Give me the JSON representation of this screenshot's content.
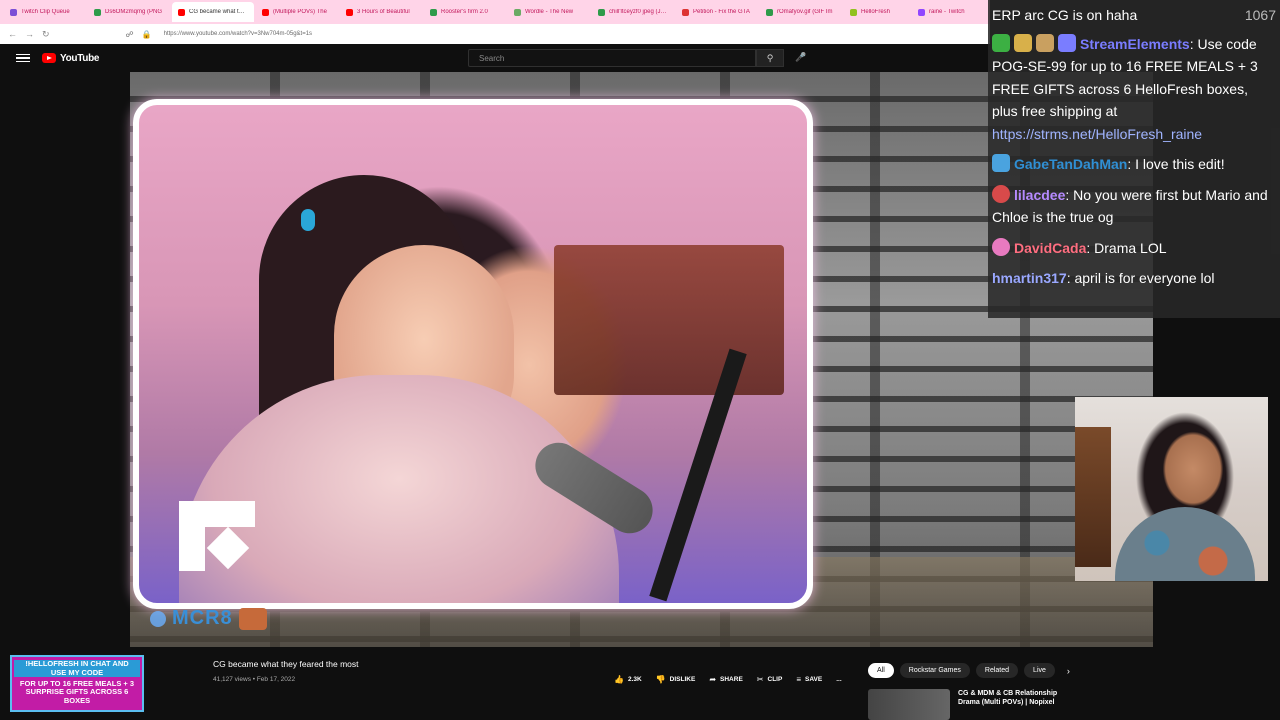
{
  "browser": {
    "tabs": [
      {
        "label": "Twitch Clip Queue",
        "color": "#7b4fd6"
      },
      {
        "label": "Ds6OM2mqmg (PNG",
        "color": "#2e9b4a"
      },
      {
        "label": "CG became what they feared",
        "color": "#ff0000",
        "active": true
      },
      {
        "label": "(Multiple POVs) The",
        "color": "#ff0000"
      },
      {
        "label": "3 Hours of Beautiful",
        "color": "#ff0000"
      },
      {
        "label": "Rooster's firm 2.0",
        "color": "#2e9b4a"
      },
      {
        "label": "Wordle - The New",
        "color": "#6aaa64"
      },
      {
        "label": "chill'ltceyzf0 jpeg (JPEG",
        "color": "#2e9b4a"
      },
      {
        "label": "Petition - Fix the GTA",
        "color": "#d33"
      },
      {
        "label": "rOmafyov.gif (GIF Im",
        "color": "#2e9b4a"
      },
      {
        "label": "HelloFresh",
        "color": "#91c11e"
      },
      {
        "label": "raine - Twitch",
        "color": "#9146ff"
      }
    ],
    "url": "https://www.youtube.com/watch?v=3Nw704m-05g&t=1s"
  },
  "youtube": {
    "brand": "YouTube",
    "search_placeholder": "Search",
    "video_title": "CG became what they feared the most",
    "video_meta": "41,127 views • Feb 17, 2022",
    "actions": {
      "like": "2.3K",
      "dislike": "DISLIKE",
      "share": "SHARE",
      "clip": "CLIP",
      "save": "SAVE",
      "more": "..."
    },
    "chips": [
      "All",
      "Rockstar Games",
      "Related",
      "Live"
    ],
    "related_title": "CG & MDM & CB Relationship Drama (Multi POVs) | Nopixel"
  },
  "stream": {
    "streamer_label": "MCR8",
    "viewer_count": "1067",
    "promo": {
      "line1": "!HELLOFRESH IN CHAT AND USE MY CODE",
      "line2": "FOR UP TO 16 FREE MEALS + 3 SURPRISE GIFTS ACROSS 6 BOXES"
    }
  },
  "chat": [
    {
      "user": "",
      "text": "ERP arc CG is on haha",
      "color": "#ffffff"
    },
    {
      "user": "StreamElements",
      "text": ": Use code POG-SE-99 for up to 16 FREE MEALS + 3 FREE GIFTS across 6 HelloFresh boxes, plus free shipping at ",
      "link": "https://strms.net/HelloFresh_raine",
      "color": "#7a7dff"
    },
    {
      "user": "GabeTanDahMan",
      "text": ": I love this edit!",
      "color": "#2f8fd4"
    },
    {
      "user": "lilacdee",
      "text": ": No you were first but Mario and Chloe is the true og",
      "color": "#b58aff"
    },
    {
      "user": "DavidCada",
      "text": ": Drama LOL",
      "color": "#ff6e80"
    },
    {
      "user": "hmartin317",
      "text": ": april is for everyone lol",
      "color": "#9aa8ff"
    }
  ]
}
